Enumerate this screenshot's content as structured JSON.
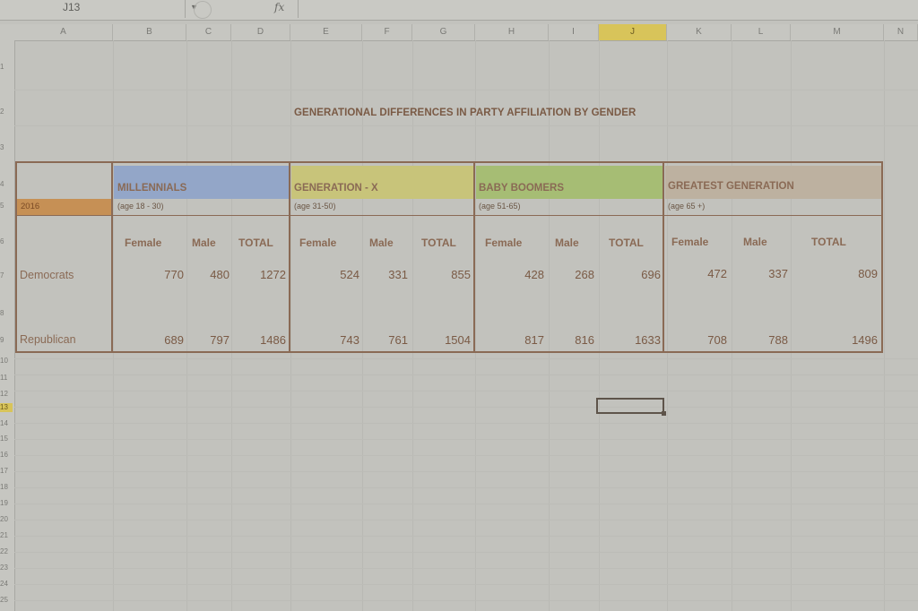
{
  "formula_bar": {
    "name_box": "J13",
    "fx_label": "fx",
    "formula": ""
  },
  "columns": [
    "A",
    "B",
    "C",
    "D",
    "E",
    "F",
    "G",
    "H",
    "I",
    "J",
    "K",
    "L",
    "M",
    "N"
  ],
  "selected_column": "J",
  "rows": [
    "1",
    "2",
    "3",
    "4",
    "5",
    "6",
    "7",
    "8",
    "9",
    "10",
    "11",
    "12",
    "13",
    "14",
    "15",
    "16",
    "17",
    "18",
    "19",
    "20",
    "21",
    "22",
    "23",
    "24",
    "25"
  ],
  "selected_row": "13",
  "table": {
    "title": "GENERATIONAL DIFFERENCES IN PARTY AFFILIATION BY GENDER",
    "year": "2016",
    "generations": [
      {
        "name": "MILLENNIALS",
        "age": "(age 18 - 30)",
        "color": "#93a6c8"
      },
      {
        "name": "GENERATION - X",
        "age": "(age 31-50)",
        "color": "#c8c47a"
      },
      {
        "name": "BABY BOOMERS",
        "age": "(age 51-65)",
        "color": "#a6bd74"
      },
      {
        "name": "GREATEST GENERATION",
        "age": "(age 65 +)",
        "color": "#bdb1a0"
      }
    ],
    "subheaders": [
      "Female",
      "Male",
      "TOTAL"
    ],
    "row_labels": [
      "Democrats",
      "Republican"
    ],
    "democrats": [
      [
        "770",
        "480",
        "1272"
      ],
      [
        "524",
        "331",
        "855"
      ],
      [
        "428",
        "268",
        "696"
      ],
      [
        "472",
        "337",
        "809"
      ]
    ],
    "republican": [
      [
        "689",
        "797",
        "1486"
      ],
      [
        "743",
        "761",
        "1504"
      ],
      [
        "817",
        "816",
        "1633"
      ],
      [
        "708",
        "788",
        "1496"
      ]
    ]
  }
}
